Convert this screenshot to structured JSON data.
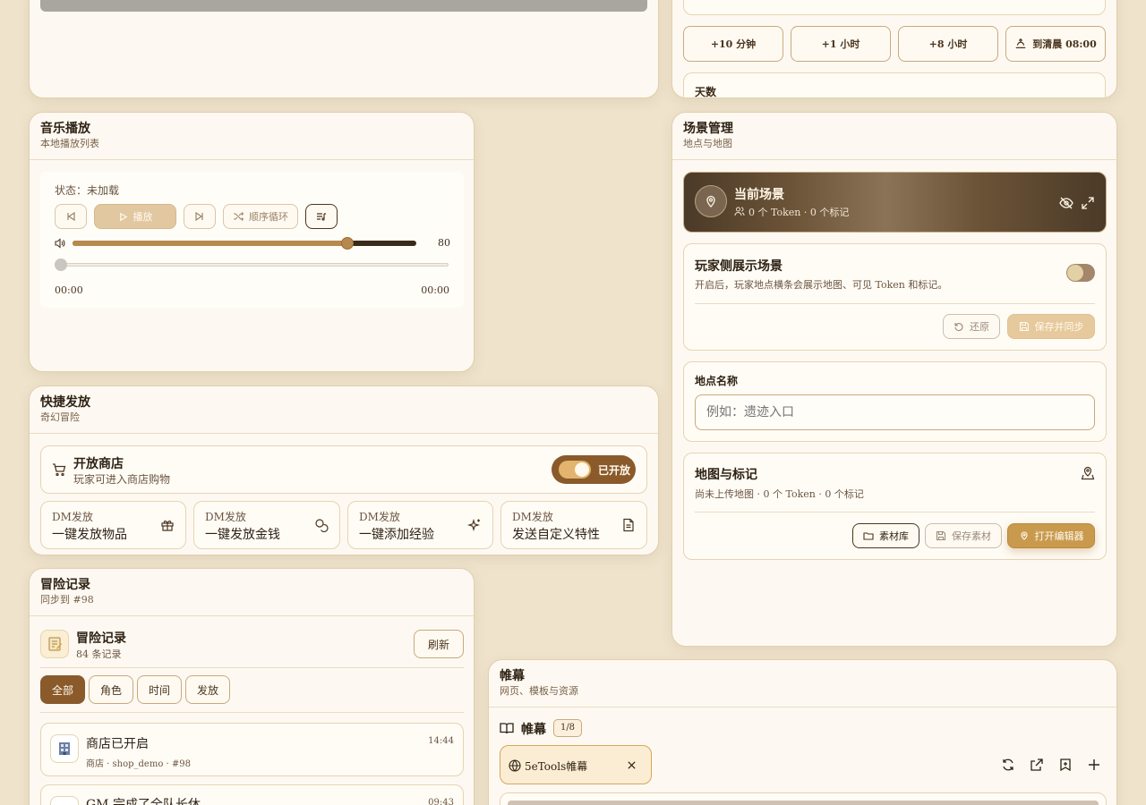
{
  "time_panel": {
    "quick_buttons": [
      {
        "label": "+10 分钟"
      },
      {
        "label": "+1 小时"
      },
      {
        "label": "+8 小时"
      },
      {
        "label": "到清晨 08:00",
        "icon": "sunrise-icon"
      }
    ],
    "days_label": "天数"
  },
  "music": {
    "title": "音乐播放",
    "subtitle": "本地播放列表",
    "status_label": "状态：",
    "status_value": "未加载",
    "play_label": "播放",
    "loop_label": "顺序循环",
    "volume_value": "80",
    "volume_level": 0.8,
    "progress_level": 0,
    "time_current": "00:00",
    "time_total": "00:00"
  },
  "quick_release": {
    "title": "快捷发放",
    "subtitle": "奇幻冒险",
    "shop_title": "开放商店",
    "shop_desc": "玩家可进入商店购物",
    "shop_toggle_label": "已开放",
    "shop_open": true,
    "actions": [
      {
        "tag": "DM发放",
        "label": "一键发放物品",
        "icon": "gift-icon"
      },
      {
        "tag": "DM发放",
        "label": "一键发放金钱",
        "icon": "coins-icon"
      },
      {
        "tag": "DM发放",
        "label": "一键添加经验",
        "icon": "sparkles-icon"
      },
      {
        "tag": "DM发放",
        "label": "发送自定义特性",
        "icon": "document-icon"
      }
    ]
  },
  "log": {
    "title": "冒险记录",
    "subtitle": "同步到 #98",
    "header_title": "冒险记录",
    "count_label": "84 条记录",
    "refresh_label": "刷新",
    "filters": [
      "全部",
      "角色",
      "时间",
      "发放"
    ],
    "active_filter": 0,
    "entries": [
      {
        "title": "商店已开启",
        "time": "14:44",
        "meta": "商店 · shop_demo · #98",
        "icon": "shop-icon"
      },
      {
        "title": "GM 完成了全队长休",
        "time": "09:43",
        "meta": "",
        "icon": "heart-icon"
      }
    ]
  },
  "scene": {
    "title": "场景管理",
    "subtitle": "地点与地图",
    "current_title": "当前场景",
    "current_meta": "0 个 Token · 0 个标记",
    "player_title": "玩家侧展示场景",
    "player_desc": "开启后，玩家地点横条会展示地图、可见 Token 和标记。",
    "player_toggle": false,
    "restore_label": "还原",
    "save_sync_label": "保存并同步",
    "location_label": "地点名称",
    "location_placeholder": "例如：遗迹入口",
    "location_value": "",
    "map_title": "地图与标记",
    "map_meta": "尚未上传地图 · 0 个 Token · 0 个标记",
    "library_label": "素材库",
    "save_asset_label": "保存素材",
    "open_editor_label": "打开编辑器"
  },
  "curtain": {
    "title": "帷幕",
    "subtitle": "网页、模板与资源",
    "header_title": "帷幕",
    "page_badge": "1/8",
    "tab_label": "5eTools帷幕"
  },
  "colors": {
    "accent": "#8a5a2b",
    "accent_light": "#c99a5a",
    "background": "#efe3cc",
    "panel": "#fdf9f2"
  }
}
